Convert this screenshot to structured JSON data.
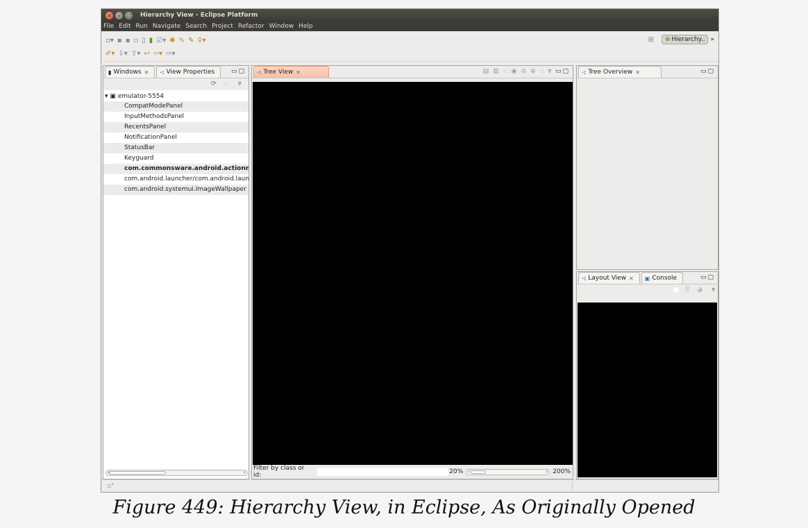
{
  "window": {
    "title": "Hierarchy View - Eclipse Platform",
    "controls": [
      "×",
      "–",
      "□"
    ]
  },
  "menubar": [
    "File",
    "Edit",
    "Run",
    "Navigate",
    "Search",
    "Project",
    "Refactor",
    "Window",
    "Help"
  ],
  "toolbar": {
    "perspective_label": "Hierarchy..",
    "overflow": "»"
  },
  "windows_panel": {
    "tab_windows": "Windows",
    "tab_view_properties": "View Properties",
    "device": "emulator-5554",
    "windows": [
      {
        "label": "CompatModePanel"
      },
      {
        "label": "InputMethodsPanel"
      },
      {
        "label": "RecentsPanel"
      },
      {
        "label": "NotificationPanel"
      },
      {
        "label": "StatusBar"
      },
      {
        "label": "Keyguard"
      },
      {
        "label": "com.commonsware.android.actionmoc"
      },
      {
        "label": "com.android.launcher/com.android.laun"
      },
      {
        "label": "com.android.systemui.ImageWallpaper"
      }
    ]
  },
  "tree_view": {
    "tab": "Tree View",
    "filter_label": "Filter by class or id:",
    "filter_value": "",
    "zoom_min": "20%",
    "zoom_max": "200%",
    "zoom_level": 0.1
  },
  "tree_overview": {
    "tab": "Tree Overview"
  },
  "layout_panel": {
    "tab_layout": "Layout View",
    "tab_console": "Console"
  },
  "caption": "Figure 449: Hierarchy View, in Eclipse, As Originally Opened"
}
